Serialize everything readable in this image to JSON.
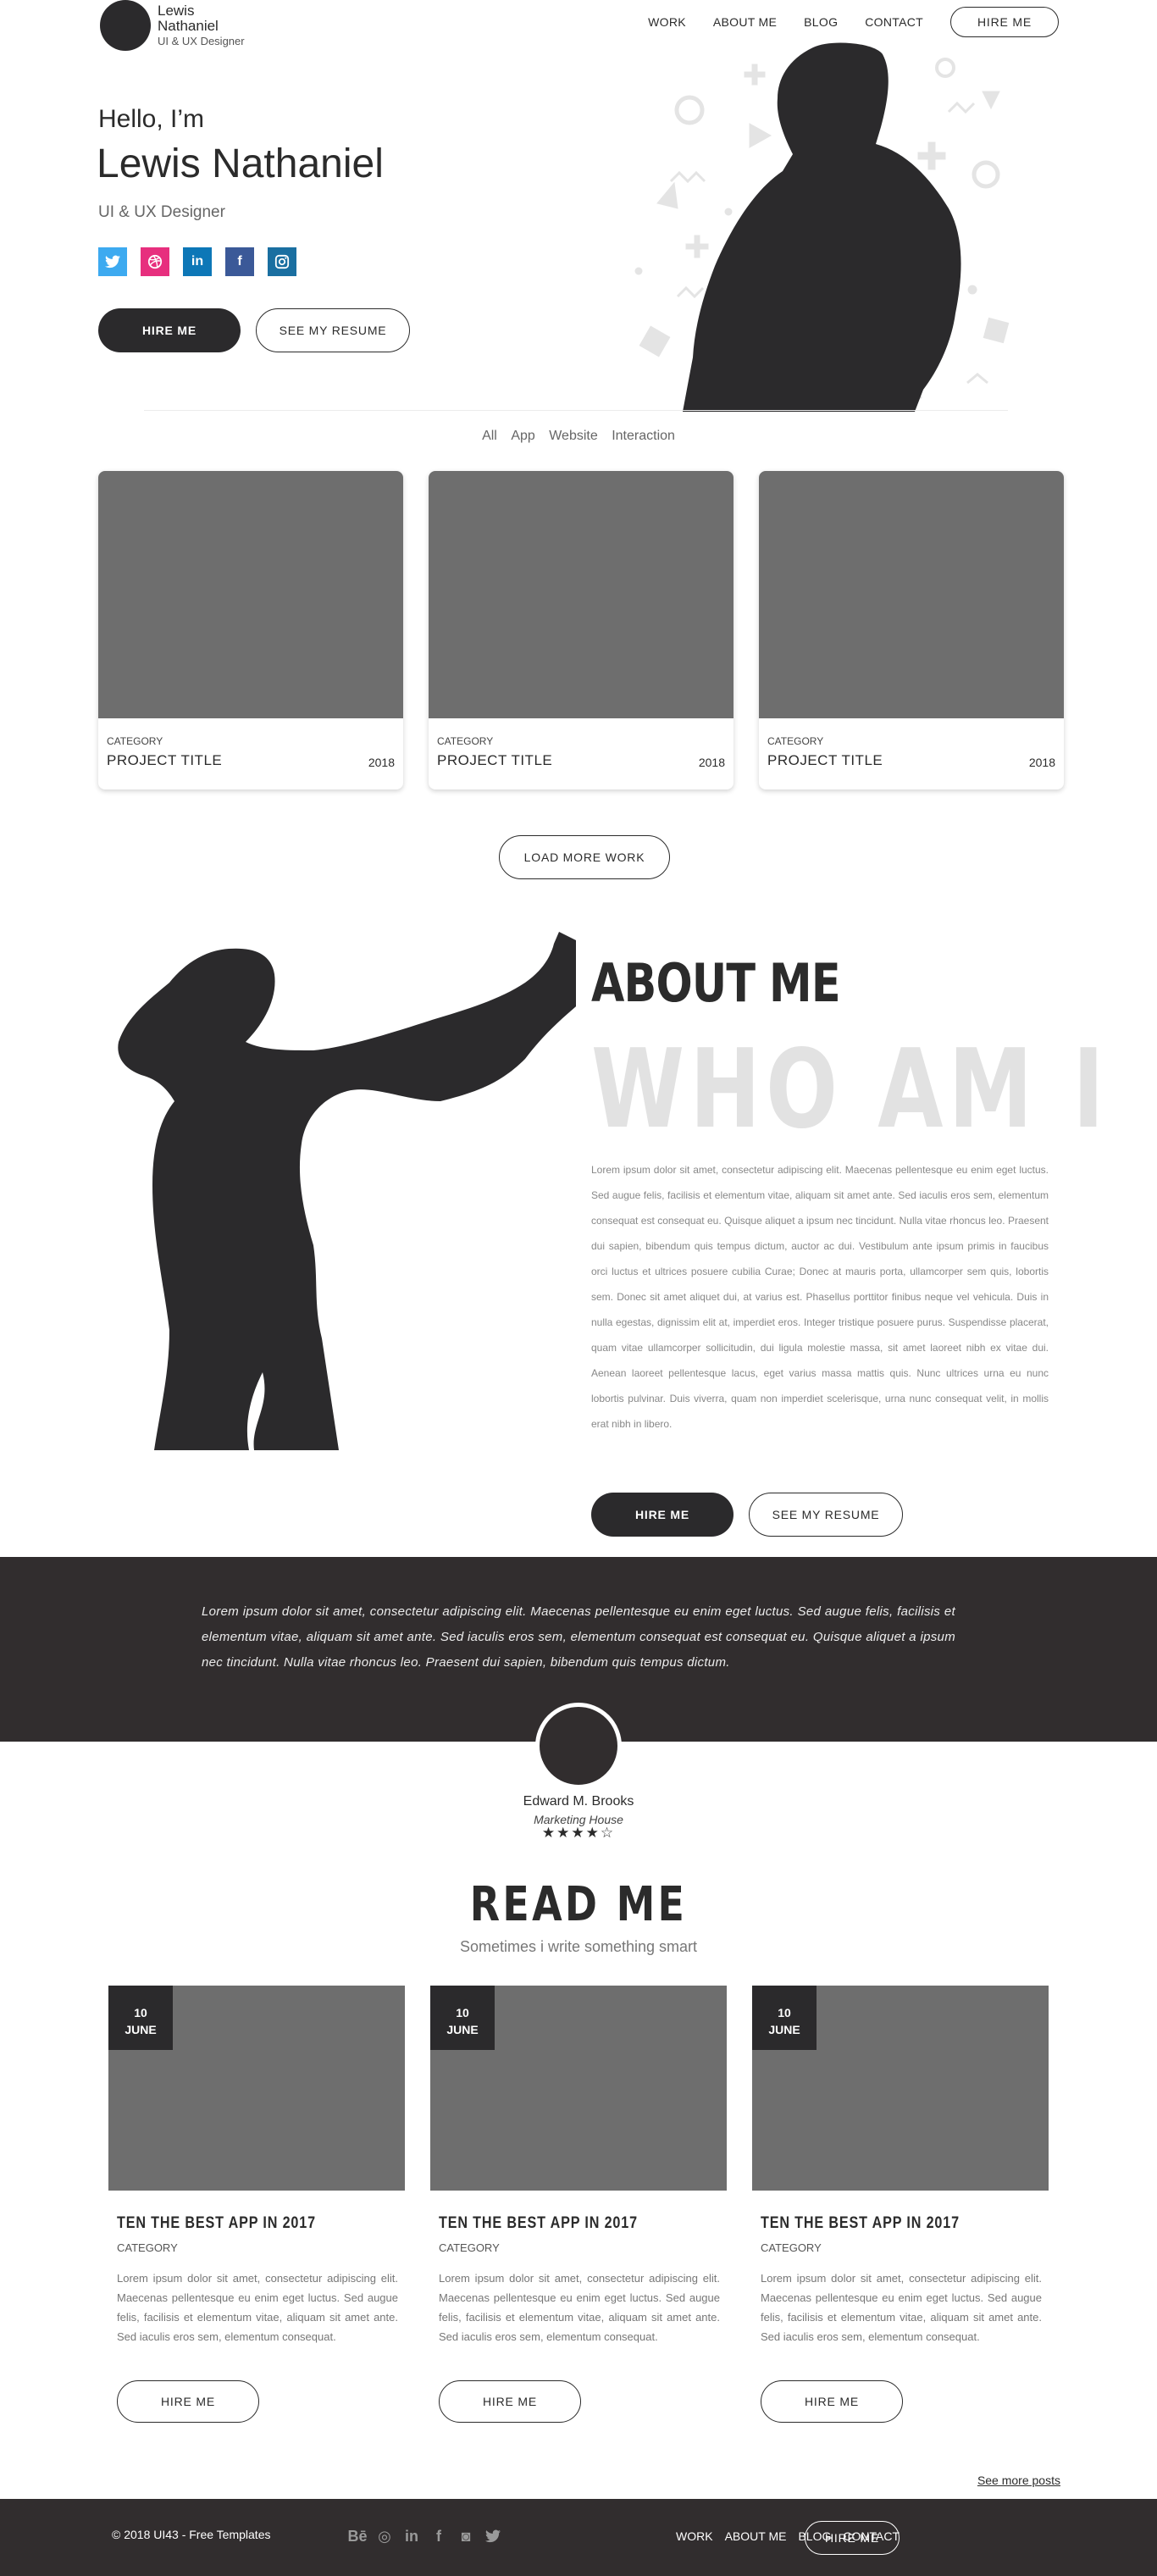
{
  "header": {
    "brand_name": "Lewis Nathaniel",
    "brand_role": "UI & UX Designer",
    "nav": [
      "WORK",
      "ABOUT ME",
      "BLOG",
      "CONTACT"
    ],
    "cta": "HIRE ME"
  },
  "hero": {
    "hello": "Hello, I’m",
    "name": "Lewis Nathaniel",
    "role": "UI & UX Designer",
    "socials": [
      {
        "icon": "twitter-icon",
        "color": "#3daaf0"
      },
      {
        "icon": "dribbble-icon",
        "color": "#e72f7e"
      },
      {
        "icon": "linkedin-icon",
        "color": "#0d77b7"
      },
      {
        "icon": "facebook-icon",
        "color": "#3b5998"
      },
      {
        "icon": "instagram-icon",
        "color": "#1a6fa1"
      }
    ],
    "primary_btn": "HIRE ME",
    "secondary_btn": "SEE MY RESUME"
  },
  "filters": [
    "All",
    "App",
    "Website",
    "Interaction"
  ],
  "projects": [
    {
      "category": "CATEGORY",
      "title": "PROJECT TITLE",
      "year": "2018"
    },
    {
      "category": "CATEGORY",
      "title": "PROJECT TITLE",
      "year": "2018"
    },
    {
      "category": "CATEGORY",
      "title": "PROJECT TITLE",
      "year": "2018"
    }
  ],
  "load_more": "LOAD MORE WORK",
  "about": {
    "title": "ABOUT ME",
    "subtitle": "WHO AM I",
    "text": "Lorem ipsum dolor sit amet, consectetur adipiscing elit. Maecenas pellentesque eu enim eget luctus. Sed augue felis, facilisis et elementum vitae, aliquam sit amet ante. Sed iaculis eros sem, elementum consequat est consequat eu. Quisque aliquet a ipsum nec tincidunt. Nulla vitae rhoncus leo. Praesent dui sapien, bibendum quis tempus dictum, auctor ac dui. Vestibulum ante ipsum primis in faucibus orci luctus et ultrices posuere cubilia Curae; Donec at mauris porta, ullamcorper sem quis, lobortis sem. Donec sit amet aliquet dui, at varius est. Phasellus porttitor finibus neque vel vehicula. Duis in nulla egestas, dignissim elit at, imperdiet eros. Integer tristique posuere purus. Suspendisse placerat, quam vitae ullamcorper sollicitudin, dui ligula molestie massa, sit amet laoreet nibh ex vitae dui. Aenean laoreet pellentesque lacus, eget varius massa mattis quis. Nunc ultrices urna eu nunc lobortis pulvinar. Duis viverra, quam non imperdiet scelerisque, urna nunc consequat velit, in mollis erat nibh in libero.",
    "primary_btn": "HIRE ME",
    "secondary_btn": "SEE MY RESUME"
  },
  "testimonial": {
    "quote": "Lorem ipsum dolor sit amet, consectetur adipiscing elit. Maecenas pellentesque eu enim eget luctus. Sed augue felis, facilisis et elementum vitae, aliquam sit amet ante. Sed iaculis eros sem, elementum consequat est consequat eu. Quisque aliquet a ipsum nec tincidunt. Nulla vitae rhoncus leo. Praesent dui sapien, bibendum quis tempus dictum.",
    "name": "Edward M. Brooks",
    "company": "Marketing House",
    "stars": "★★★★☆",
    "rating": 4.5
  },
  "blog": {
    "title": "READ ME",
    "subtitle": "Sometimes i write something smart",
    "posts": [
      {
        "day": "10",
        "month": "JUNE",
        "title": "TEN THE BEST APP IN 2017",
        "category": "CATEGORY",
        "text": "Lorem ipsum dolor sit amet, consectetur adipiscing elit. Maecenas pellentesque eu enim eget luctus. Sed augue felis, facilisis et elementum vitae, aliquam sit amet ante. Sed iaculis eros sem, elementum consequat.",
        "button": "HIRE ME"
      },
      {
        "day": "10",
        "month": "JUNE",
        "title": "TEN THE BEST APP IN 2017",
        "category": "CATEGORY",
        "text": "Lorem ipsum dolor sit amet, consectetur adipiscing elit. Maecenas pellentesque eu enim eget luctus. Sed augue felis, facilisis et elementum vitae, aliquam sit amet ante. Sed iaculis eros sem, elementum consequat.",
        "button": "HIRE ME"
      },
      {
        "day": "10",
        "month": "JUNE",
        "title": "TEN THE BEST APP IN 2017",
        "category": "CATEGORY",
        "text": "Lorem ipsum dolor sit amet, consectetur adipiscing elit. Maecenas pellentesque eu enim eget luctus. Sed augue felis, facilisis et elementum vitae, aliquam sit amet ante. Sed iaculis eros sem, elementum consequat.",
        "button": "HIRE ME"
      }
    ],
    "see_more": "See more posts"
  },
  "footer": {
    "copyright": "© 2018 UI43 - Free Templates",
    "icons": [
      {
        "name": "behance-icon",
        "glyph": "Bē"
      },
      {
        "name": "dribbble-icon",
        "glyph": "◎"
      },
      {
        "name": "linkedin-icon",
        "glyph": "in"
      },
      {
        "name": "facebook-icon",
        "glyph": "f"
      },
      {
        "name": "instagram-icon",
        "glyph": "◙"
      },
      {
        "name": "twitter-icon",
        "glyph": "🐦"
      }
    ],
    "nav": [
      "WORK",
      "ABOUT ME",
      "BLOG",
      "CONTACT"
    ],
    "cta": "HIRE ME"
  },
  "colors": {
    "dark": "#2b2a2c",
    "band": "#312d2e",
    "placeholder": "#6e6e6e"
  }
}
